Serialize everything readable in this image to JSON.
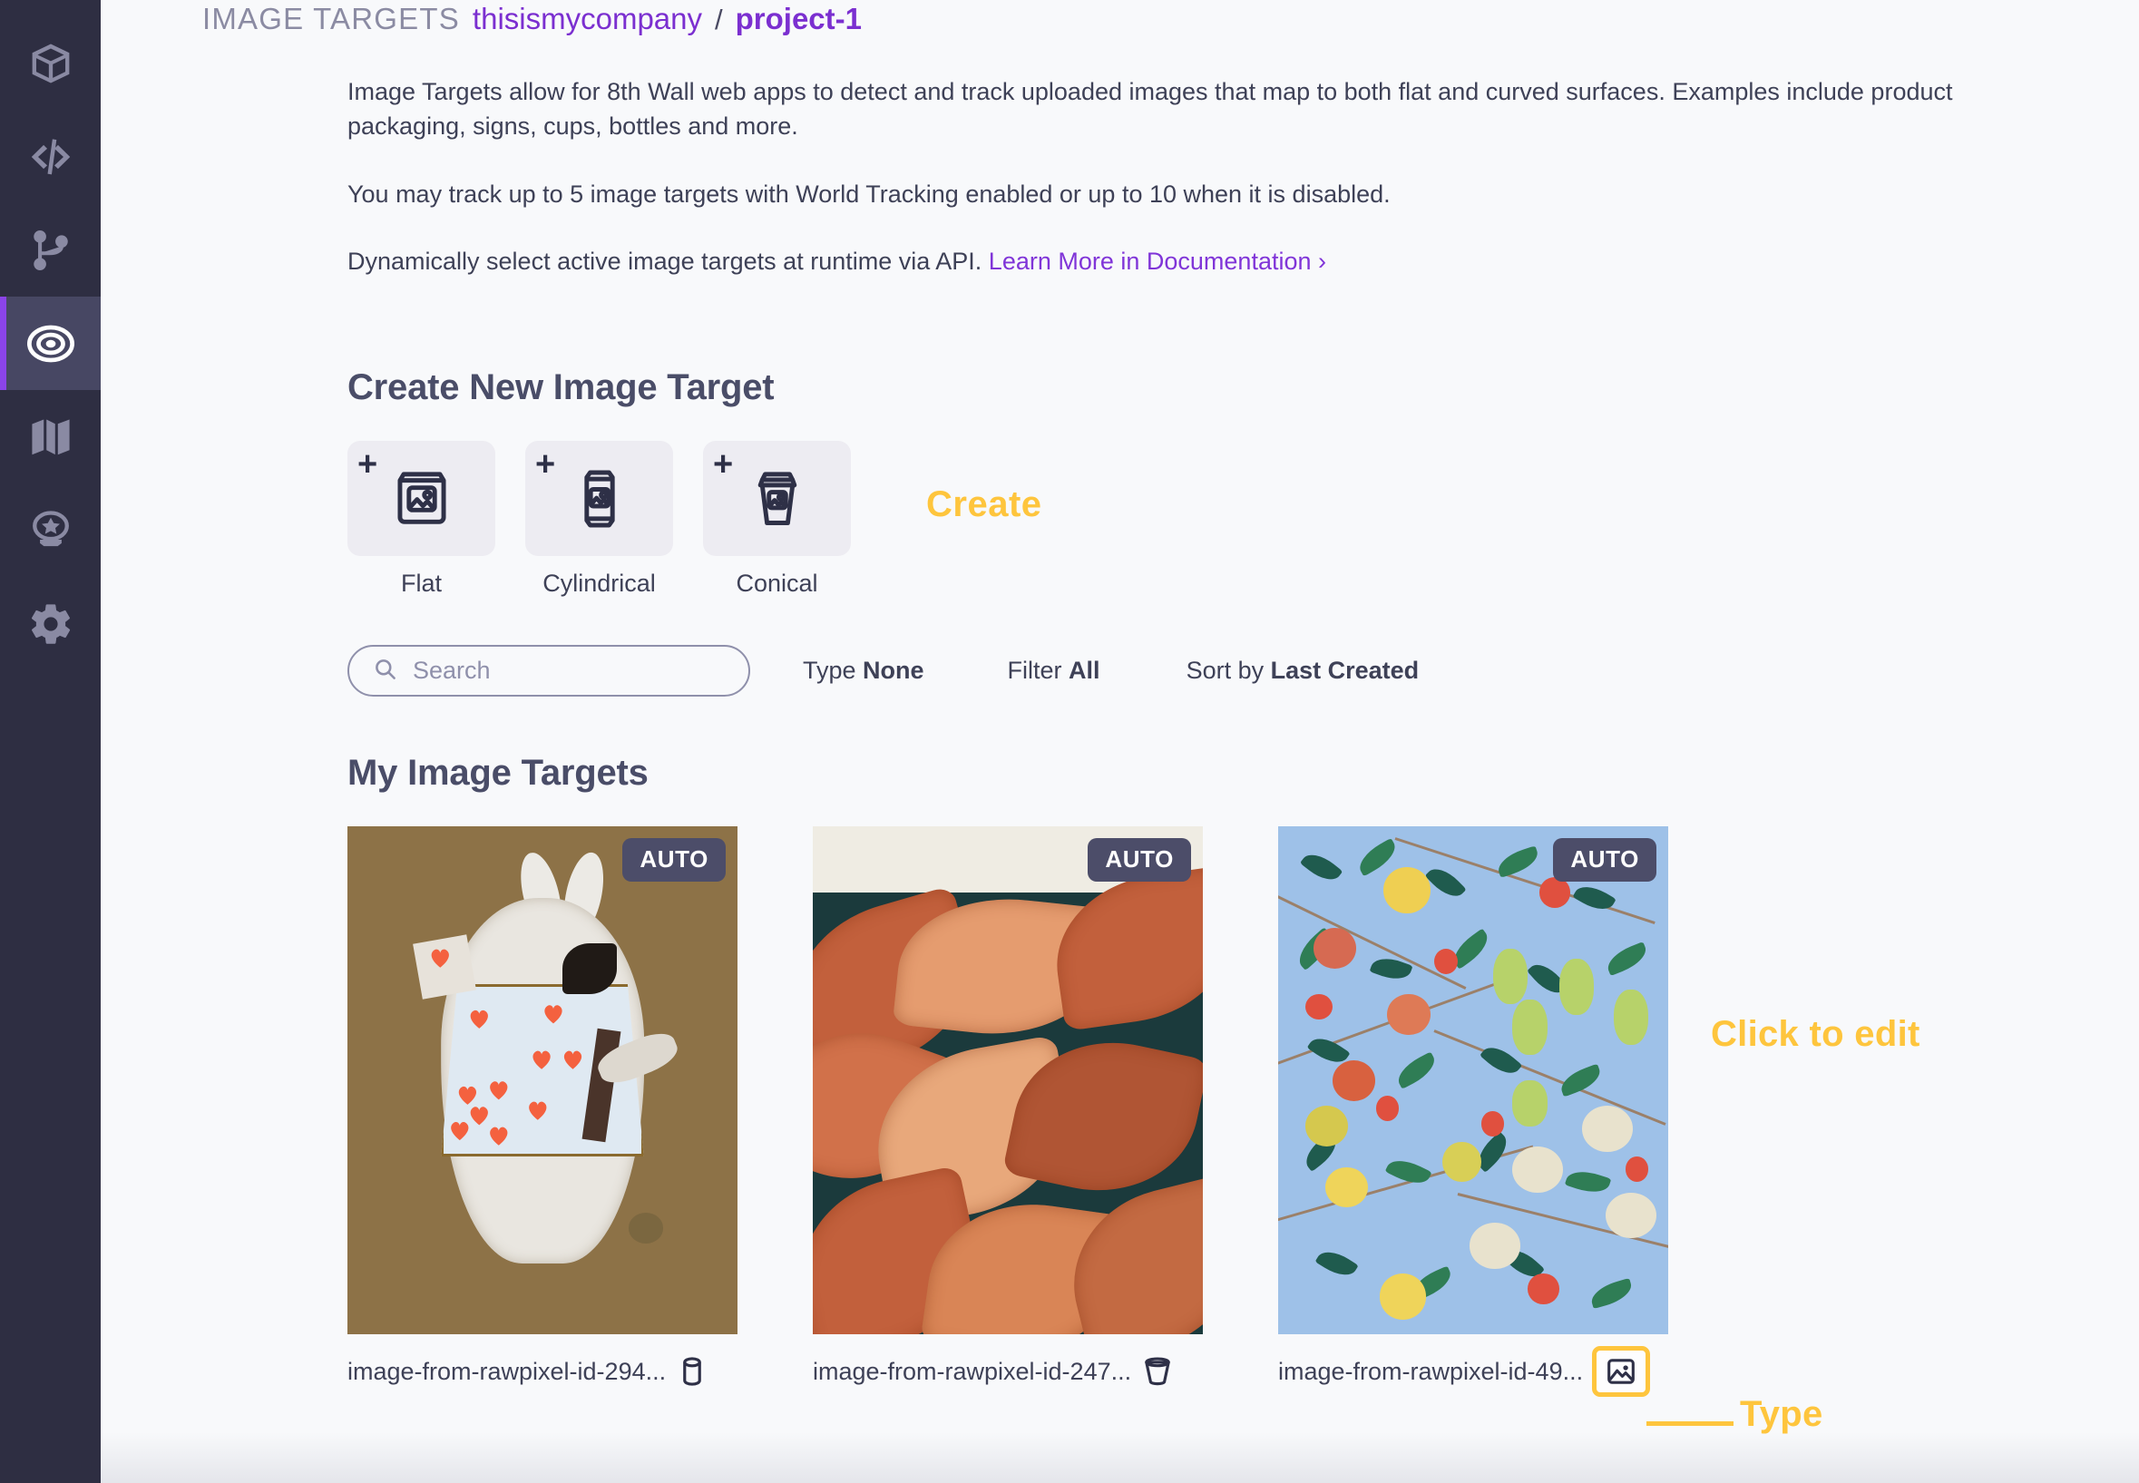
{
  "sidebar": {
    "items": [
      {
        "name": "workspace",
        "icon": "cube-icon",
        "active": false
      },
      {
        "name": "code",
        "icon": "code-brackets-icon",
        "active": false
      },
      {
        "name": "version-control",
        "icon": "git-branch-icon",
        "active": false
      },
      {
        "name": "image-targets",
        "icon": "target-icon",
        "active": true
      },
      {
        "name": "map",
        "icon": "map-icon",
        "active": false
      },
      {
        "name": "badge",
        "icon": "award-badge-icon",
        "active": false
      },
      {
        "name": "settings",
        "icon": "gear-icon",
        "active": false
      }
    ]
  },
  "breadcrumb": {
    "label": "IMAGE TARGETS",
    "company": "thisismycompany",
    "separator": "/",
    "project": "project-1"
  },
  "intro": {
    "p1": "Image Targets allow for 8th Wall web apps to detect and track uploaded images that map to both flat and curved surfaces. Examples include product packaging, signs, cups, bottles and more.",
    "p2": "You may track up to 5 image targets with World Tracking enabled or up to 10 when it is disabled.",
    "p3_prefix": "Dynamically select active image targets at runtime via API. ",
    "p3_link": "Learn More in Documentation ›"
  },
  "create": {
    "heading": "Create New Image Target",
    "annotation": "Create",
    "plus": "+",
    "cards": [
      {
        "label": "Flat",
        "icon": "flat-image-icon"
      },
      {
        "label": "Cylindrical",
        "icon": "can-icon"
      },
      {
        "label": "Conical",
        "icon": "cup-icon"
      }
    ]
  },
  "filters": {
    "search_placeholder": "Search",
    "search_value": "",
    "search_icon": "search-icon",
    "type_label": "Type ",
    "type_value": "None",
    "filter_label": "Filter ",
    "filter_value": "All",
    "sort_label": "Sort by ",
    "sort_value": "Last Created"
  },
  "targets": {
    "heading": "My Image Targets",
    "annotation_edit": "Click to edit",
    "annotation_type": "Type",
    "items": [
      {
        "name": "image-from-rawpixel-id-294...",
        "badge": "AUTO",
        "type_icon": "cylinder-icon",
        "art": "white-rabbit-illustration"
      },
      {
        "name": "image-from-rawpixel-id-247...",
        "badge": "AUTO",
        "type_icon": "cone-icon",
        "art": "acanthus-leaves-pattern"
      },
      {
        "name": "image-from-rawpixel-id-49...",
        "badge": "AUTO",
        "type_icon": "flat-image-icon",
        "art": "fruit-pattern-blue",
        "highlighted": true
      }
    ]
  },
  "colors": {
    "sidebar_bg": "#2e2e42",
    "accent_purple": "#7b2fd0",
    "active_bar": "#8b44e8",
    "annotation_yellow": "#fec53d",
    "badge_bg": "#4c4d69",
    "page_bg": "#f8f9fb",
    "text": "#3e4157"
  }
}
